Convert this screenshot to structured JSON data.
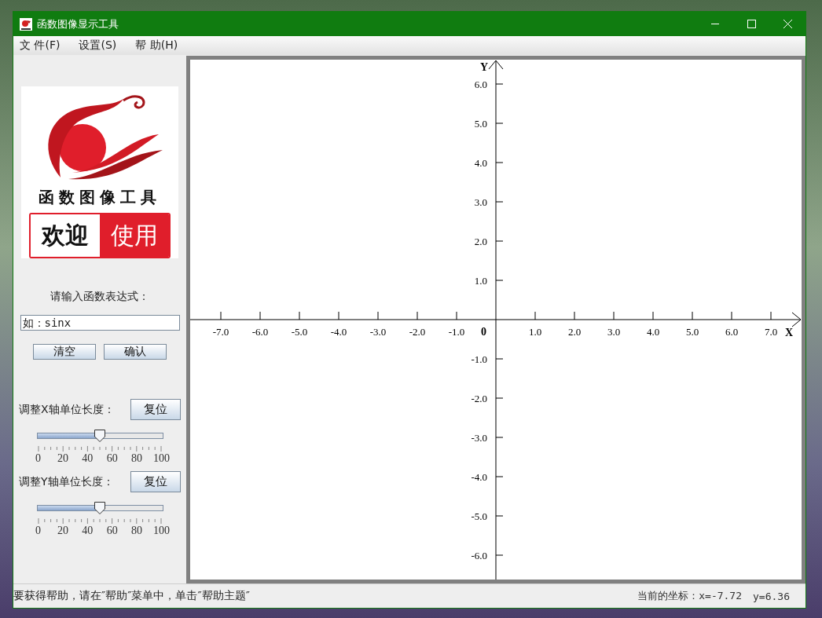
{
  "window": {
    "title": "函数图像显示工具"
  },
  "menu": [
    {
      "label": "文 件(F)"
    },
    {
      "label": "设置(S)"
    },
    {
      "label": "帮 助(H)"
    }
  ],
  "logo": {
    "title": "函数图像工具",
    "banner_left": "欢迎",
    "banner_right": "使用"
  },
  "expression": {
    "label": "请输入函数表达式：",
    "placeholder": "如：sinx"
  },
  "buttons": [
    "清空",
    "确认"
  ],
  "scales": [
    {
      "label": "调整X轴单位长度：",
      "reset": "复位",
      "level": 0.5,
      "ticks": [
        "0",
        "20",
        "40",
        "60",
        "80",
        "100"
      ]
    },
    {
      "label": "调整Y轴单位长度：",
      "reset": "复位",
      "level": 0.5,
      "ticks": [
        "0",
        "20",
        "40",
        "60",
        "80",
        "100"
      ]
    }
  ],
  "plot": {
    "x_label": "X",
    "y_label": "Y",
    "origin": "0",
    "x_ticks": [
      "-7.0",
      "-6.0",
      "-5.0",
      "-4.0",
      "-3.0",
      "-2.0",
      "-1.0",
      "1.0",
      "2.0",
      "3.0",
      "4.0",
      "5.0",
      "6.0",
      "7.0"
    ],
    "y_ticks": [
      "6.0",
      "5.0",
      "4.0",
      "3.0",
      "2.0",
      "1.0",
      "-1.0",
      "-2.0",
      "-3.0",
      "-4.0",
      "-5.0",
      "-6.0"
    ]
  },
  "status": {
    "hint": "要获得帮助，请在″帮助″菜单中，单击″帮助主题″",
    "coord": "当前的坐标：x=-7.72",
    "y": "y=6.36"
  }
}
